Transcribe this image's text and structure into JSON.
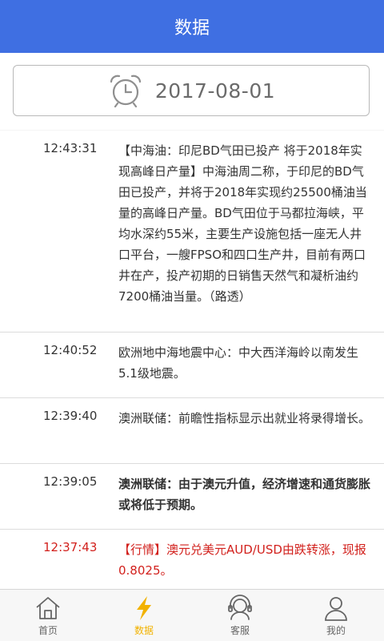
{
  "header": {
    "title": "数据"
  },
  "date_picker": {
    "value": "2017-08-01",
    "icon": "alarm-clock-icon"
  },
  "news": [
    {
      "time": "12:43:31",
      "text": "【中海油：印尼BD气田已投产 将于2018年实现高峰日产量】中海油周二称，于印尼的BD气田已投产，并将于2018年实现约25500桶油当量的高峰日产量。BD气田位于马都拉海峡，平均水深约55米，主要生产设施包括一座无人井口平台，一艘FPSO和四口生产井，目前有两口井在产，投产初期的日销售天然气和凝析油约7200桶油当量。（路透）",
      "style": "normal"
    },
    {
      "time": "12:40:52",
      "text": "欧洲地中海地震中心：中大西洋海岭以南发生5.1级地震。",
      "style": "normal"
    },
    {
      "time": "12:39:40",
      "text": "澳洲联储：前瞻性指标显示出就业将录得增长。",
      "style": "normal"
    },
    {
      "time": "12:39:05",
      "text": "澳洲联储：由于澳元升值，经济增速和通货膨胀或将低于预期。",
      "style": "bold"
    },
    {
      "time": "12:37:43",
      "text": "【行情】澳元兑美元AUD/USD由跌转涨，现报0.8025。",
      "style": "red"
    }
  ],
  "tabbar": {
    "items": [
      {
        "label": "首页",
        "icon": "home-icon",
        "active": false
      },
      {
        "label": "数据",
        "icon": "lightning-icon",
        "active": true
      },
      {
        "label": "客服",
        "icon": "headset-icon",
        "active": false
      },
      {
        "label": "我的",
        "icon": "user-icon",
        "active": false
      }
    ]
  },
  "colors": {
    "header": "#3f6fe2",
    "accent": "#f2b200",
    "alert": "#d2211d"
  }
}
